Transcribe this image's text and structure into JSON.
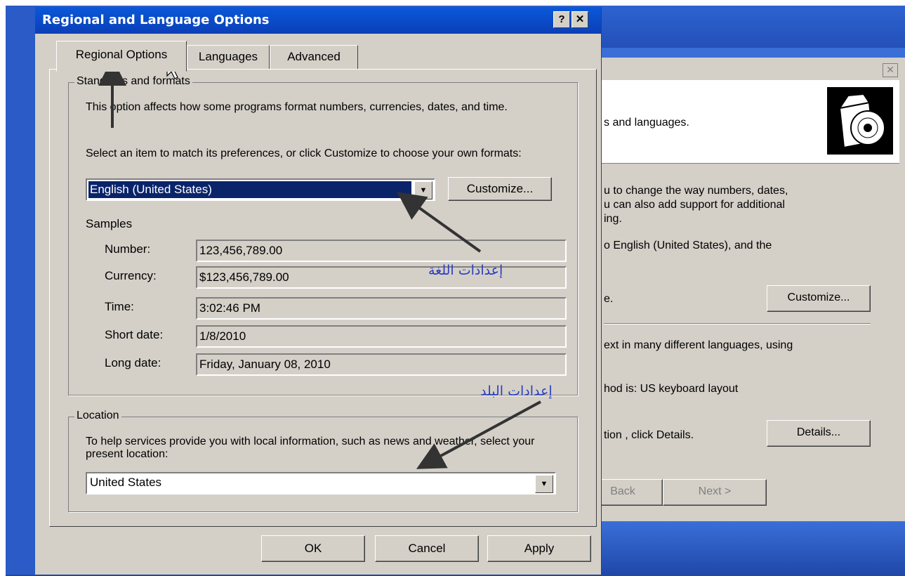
{
  "dialog": {
    "title": "Regional and Language Options",
    "help_button": "?",
    "close_button": "✕",
    "tabs": [
      {
        "label": "Regional Options"
      },
      {
        "label": "Languages"
      },
      {
        "label": "Advanced"
      }
    ],
    "standards": {
      "legend": "Standards and formats",
      "description": "This option affects how some programs format numbers, currencies, dates, and time.",
      "select_prompt": "Select an item to match its preferences, or click Customize to choose your own formats:",
      "selected_format": "English (United States)",
      "customize_label": "Customize...",
      "samples_heading": "Samples",
      "samples": [
        {
          "label": "Number:",
          "value": "123,456,789.00"
        },
        {
          "label": "Currency:",
          "value": "$123,456,789.00"
        },
        {
          "label": "Time:",
          "value": "3:02:46 PM"
        },
        {
          "label": "Short date:",
          "value": "1/8/2010"
        },
        {
          "label": "Long date:",
          "value": "Friday, January 08, 2010"
        }
      ]
    },
    "location": {
      "legend": "Location",
      "description": "To help services provide you with local information, such as news and weather, select your present location:",
      "selected_location": "United States"
    },
    "footer": {
      "ok": "OK",
      "cancel": "Cancel",
      "apply": "Apply"
    }
  },
  "annotations": {
    "language_settings": "إعدادات اللغة",
    "country_settings": "إعدادات البلد"
  },
  "background_window": {
    "close_button": "✕",
    "header_text": "s and languages.",
    "line1": "u to change the way numbers, dates,",
    "line2": "u can also add support for additional",
    "line3": "ing.",
    "line4": "o English (United States), and the",
    "line5": "e.",
    "customize_label": "Customize...",
    "line6": "ext in many different languages, using",
    "line7": "hod is: US keyboard layout",
    "line8": "tion , click Details.",
    "details_label": "Details...",
    "back_label": "Back",
    "next_label": "Next >"
  },
  "colors": {
    "title_bar": "#0b4fcc",
    "selection": "#0a246a",
    "dialog_face": "#d4d0c8",
    "annotation_text": "#2a3fbf",
    "arrow": "#333333"
  }
}
